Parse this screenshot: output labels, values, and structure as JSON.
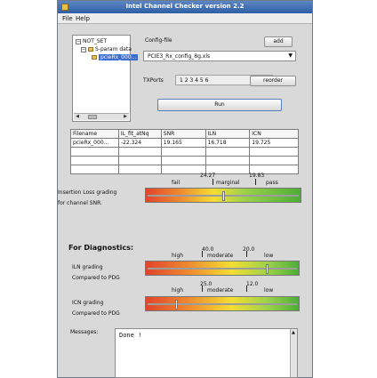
{
  "window": {
    "title": "Intel Channel Checker version 2.2"
  },
  "menu": [
    "File",
    "Help"
  ],
  "tree": {
    "root": "NOT_SET",
    "group": "S-param data",
    "selected": "pcieRx_000..."
  },
  "config": {
    "label": "Config-file",
    "add_label": "add",
    "file_value": "PCIE3_Rx_config_8g.xls"
  },
  "txports": {
    "label": "TXPorts",
    "value": "1 2 3 4 5 6",
    "reorder_label": "reorder"
  },
  "run_label": "Run",
  "table": {
    "columns": [
      "Filename",
      "IL_fit_atNq",
      "SNR",
      "ILN",
      "ICN"
    ],
    "rows": [
      [
        "pcieRx_000...",
        "-22.324",
        "19.165",
        "16.718",
        "19.725"
      ],
      [
        "",
        "",
        "",
        "",
        ""
      ],
      [
        "",
        "",
        "",
        "",
        ""
      ],
      [
        "",
        "",
        "",
        "",
        ""
      ]
    ]
  },
  "snr_grading": {
    "label_line1": "Insertion Loss grading",
    "label_line2": "for channel SNR.",
    "fail": "fail",
    "marginal": "marginal",
    "pass": "pass",
    "threshold1": "24.27",
    "threshold2": "19.83",
    "slider_fraction": 0.5
  },
  "diagnostics": {
    "heading": "For Diagnostics:",
    "iln": {
      "label_line1": "ILN grading",
      "label_line2": "Compared to PDG",
      "high": "high",
      "moderate": "moderate",
      "low": "low",
      "threshold1": "40.0",
      "threshold2": "20.0",
      "slider_fraction": 0.81
    },
    "icn": {
      "label_line1": "ICN grading",
      "label_line2": "Compared to PDG",
      "high": "high",
      "moderate": "moderate",
      "low": "low",
      "threshold1": "25.0",
      "threshold2": "12.0",
      "slider_fraction": 0.18
    }
  },
  "messages": {
    "label": "Messages:",
    "text": "Done !"
  },
  "colors": {
    "bar_low": "#e2432c",
    "bar_mid": "#f4de32",
    "bar_high": "#4cae36",
    "selection": "#3b6ed0"
  }
}
